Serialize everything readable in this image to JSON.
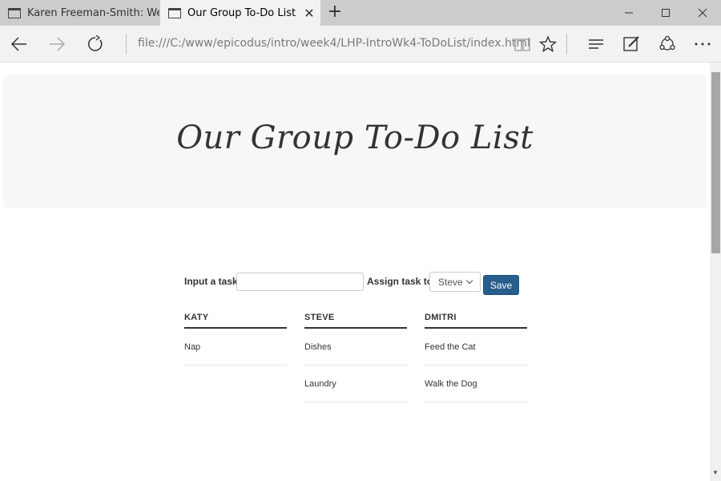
{
  "tabs": [
    {
      "title": "Karen Freeman-Smith: Web"
    },
    {
      "title": "Our Group To-Do List"
    }
  ],
  "address": {
    "url": "file:///C:/www/epicodus/intro/week4/LHP-IntroWk4-ToDoList/index.html"
  },
  "page": {
    "title": "Our Group To-Do List",
    "form": {
      "task_label": "Input a task:",
      "task_value": "",
      "assign_label": "Assign task to:",
      "assignee": "Steve",
      "save_label": "Save"
    },
    "columns": [
      {
        "name": "KATY",
        "tasks": [
          "Nap"
        ]
      },
      {
        "name": "STEVE",
        "tasks": [
          "Dishes",
          "Laundry"
        ]
      },
      {
        "name": "DMITRI",
        "tasks": [
          "Feed the Cat",
          "Walk the Dog"
        ]
      }
    ]
  },
  "colors": {
    "accent": "#285e8e",
    "tabbar": "#cccccc"
  }
}
